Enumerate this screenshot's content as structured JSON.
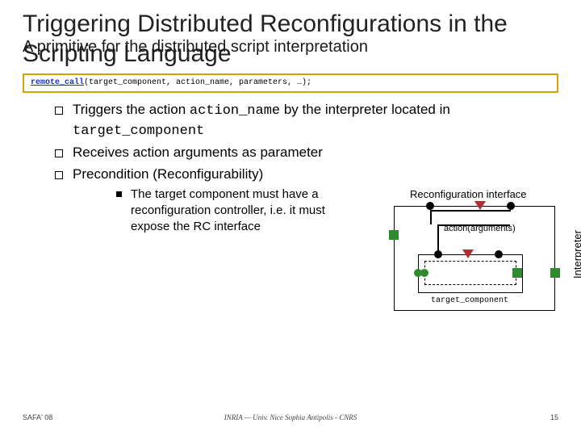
{
  "title": "Triggering Distributed Reconfigurations in the Scripting Language",
  "subtitle": "A primitive for the distributed script interpretation",
  "code": {
    "keyword": "remote_call",
    "rest": "(target_component, action_name, parameters, …);"
  },
  "bullets": {
    "b1_pre": "Triggers the action ",
    "b1_mono1": "action_name",
    "b1_mid": " by the interpreter located in ",
    "b1_mono2": "target_component",
    "b2": "Receives action arguments as parameter",
    "b3": "Precondition (Reconfigurability)",
    "sub1": "The target component must have a reconfiguration controller, i.e. it must expose the RC interface"
  },
  "diagram": {
    "reconf": "Reconfiguration interface",
    "action": "action(arguments)",
    "target": "target_component",
    "interp": "Interpreter"
  },
  "footer": {
    "left": "SAFA' 08",
    "center": "INRIA — Univ. Nice Sophia Antipolis - CNRS",
    "right": "15"
  }
}
